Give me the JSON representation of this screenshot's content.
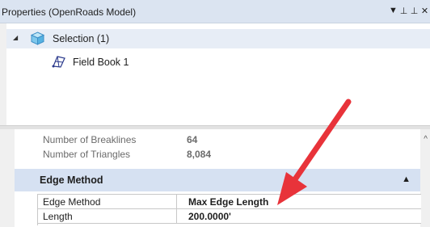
{
  "window": {
    "title": "Properties (OpenRoads Model)",
    "icons": [
      "dropdown-icon",
      "pin-icon",
      "pin-icon",
      "close-icon"
    ]
  },
  "tree": {
    "selection_label": "Selection (1)",
    "child_label": "Field Book 1"
  },
  "properties": [
    {
      "label": "Number of Breaklines",
      "value": "64"
    },
    {
      "label": "Number of Triangles",
      "value": "8,084"
    }
  ],
  "group": {
    "title": "Edge Method",
    "rows": [
      {
        "label": "Edge Method",
        "value": "Max Edge Length"
      },
      {
        "label": "Length",
        "value": "200.0000'"
      }
    ]
  },
  "colors": {
    "title_bar": "#dbe4f1",
    "group_header": "#d6e1f2",
    "annotation_arrow": "#e8333a"
  }
}
